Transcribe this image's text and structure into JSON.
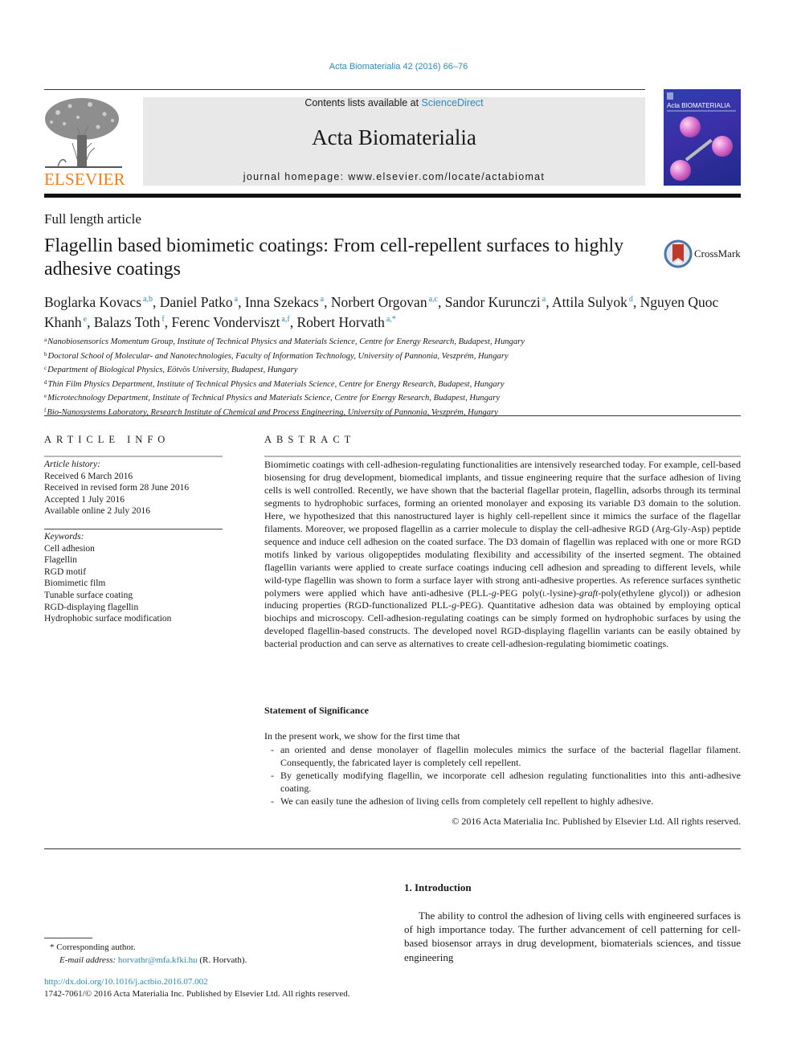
{
  "header": {
    "journal_ref": "Acta Biomaterialia 42 (2016) 66–76",
    "contents_prefix": "Contents lists available at ",
    "contents_link": "ScienceDirect",
    "journal_title": "Acta Biomaterialia",
    "homepage": "journal homepage: www.elsevier.com/locate/actabiomat",
    "publisher": "ELSEVIER",
    "cover_title": "Acta BIOMATERIALIA",
    "colors": {
      "link": "#2a8bb8",
      "elsevier_orange": "#f07d1e",
      "masthead_bg": "#e8e8e8"
    }
  },
  "article": {
    "type": "Full length article",
    "title": "Flagellin based biomimetic coatings: From cell-repellent surfaces to highly adhesive coatings",
    "crossmark_label": "CrossMark",
    "authors": [
      {
        "name": "Boglarka Kovacs",
        "aff": "a,b",
        "sep": ", "
      },
      {
        "name": "Daniel Patko",
        "aff": "a",
        "sep": ", "
      },
      {
        "name": "Inna Szekacs",
        "aff": "a",
        "sep": ", "
      },
      {
        "name": "Norbert Orgovan",
        "aff": "a,c",
        "sep": ", "
      },
      {
        "name": "Sandor Kurunczi",
        "aff": "a",
        "sep": ", "
      },
      {
        "name": "Attila Sulyok",
        "aff": "d",
        "sep": ", "
      },
      {
        "name": "Nguyen Quoc Khanh",
        "aff": "e",
        "sep": ", "
      },
      {
        "name": "Balazs Toth",
        "aff": "f",
        "sep": ", "
      },
      {
        "name": "Ferenc Vonderviszt",
        "aff": "a,f",
        "sep": ", "
      },
      {
        "name": "Robert Horvath",
        "aff": "a,*",
        "sep": ""
      }
    ],
    "affiliations": [
      {
        "key": "a",
        "text": "Nanobiosensorics Momentum Group, Institute of Technical Physics and Materials Science, Centre for Energy Research, Budapest, Hungary"
      },
      {
        "key": "b",
        "text": "Doctoral School of Molecular- and Nanotechnologies, Faculty of Information Technology, University of Pannonia, Veszprém, Hungary"
      },
      {
        "key": "c",
        "text": "Department of Biological Physics, Eötvös University, Budapest, Hungary"
      },
      {
        "key": "d",
        "text": "Thin Film Physics Department, Institute of Technical Physics and Materials Science, Centre for Energy Research, Budapest, Hungary"
      },
      {
        "key": "e",
        "text": "Microtechnology Department, Institute of Technical Physics and Materials Science, Centre for Energy Research, Budapest, Hungary"
      },
      {
        "key": "f",
        "text": "Bio-Nanosystems Laboratory, Research Institute of Chemical and Process Engineering, University of Pannonia, Veszprém, Hungary"
      }
    ]
  },
  "article_info": {
    "heading": "ARTICLE INFO",
    "history_label": "Article history:",
    "history": [
      "Received 6 March 2016",
      "Received in revised form 28 June 2016",
      "Accepted 1 July 2016",
      "Available online 2 July 2016"
    ],
    "keywords_label": "Keywords:",
    "keywords": [
      "Cell adhesion",
      "Flagellin",
      "RGD motif",
      "Biomimetic film",
      "Tunable surface coating",
      "RGD-displaying flagellin",
      "Hydrophobic surface modification"
    ]
  },
  "abstract": {
    "heading": "ABSTRACT",
    "parts": [
      "Biomimetic coatings with cell-adhesion-regulating functionalities are intensively researched today. For example, cell-based biosensing for drug development, biomedical implants, and tissue engineering require that the surface adhesion of living cells is well controlled. Recently, we have shown that the bacterial flagellar protein, flagellin, adsorbs through its terminal segments to hydrophobic surfaces, forming an oriented monolayer and exposing its variable D3 domain to the solution. Here, we hypothesized that this nanostructured layer is highly cell-repellent since it mimics the surface of the flagellar filaments. Moreover, we proposed flagellin as a carrier molecule to display the cell-adhesive RGD (Arg-Gly-Asp) peptide sequence and induce cell adhesion on the coated surface. The D3 domain of flagellin was replaced with one or more RGD motifs linked by various oligopeptides modulating flexibility and accessibility of the inserted segment. The obtained flagellin variants were applied to create surface coatings inducing cell adhesion and spreading to different levels, while wild-type flagellin was shown to form a surface layer with strong anti-adhesive properties. As reference surfaces synthetic polymers were applied which have anti-adhesive (PLL-",
      "g",
      "-PEG poly(",
      "l",
      "-lysine)-",
      "graft",
      "-poly(ethylene glycol)) or adhesion inducing properties (RGD-functionalized PLL-",
      "g",
      "-PEG). Quantitative adhesion data was obtained by employing optical biochips and microscopy. Cell-adhesion-regulating coatings can be simply formed on hydrophobic surfaces by using the developed flagellin-based constructs. The developed novel RGD-displaying flagellin variants can be easily obtained by bacterial production and can serve as alternatives to create cell-adhesion-regulating biomimetic coatings."
    ],
    "significance_heading": "Statement of Significance",
    "significance_intro": "In the present work, we show for the first time that",
    "significance_points": [
      "an oriented and dense monolayer of flagellin molecules mimics the surface of the bacterial flagellar filament. Consequently, the fabricated layer is completely cell repellent.",
      "By genetically modifying flagellin, we incorporate cell adhesion regulating functionalities into this anti-adhesive coating.",
      "We can easily tune the adhesion of living cells from completely cell repellent to highly adhesive."
    ],
    "copyright": "© 2016 Acta Materialia Inc. Published by Elsevier Ltd. All rights reserved."
  },
  "introduction": {
    "heading": "1. Introduction",
    "text": "The ability to control the adhesion of living cells with engineered surfaces is of high importance today. The further advancement of cell patterning for cell-based biosensor arrays in drug development, biomaterials sciences, and tissue engineering"
  },
  "footnotes": {
    "corresponding_mark": "*",
    "corresponding": "Corresponding author.",
    "email_label": "E-mail address:",
    "email": "horvathr@mfa.kfki.hu",
    "email_suffix": " (R. Horvath).",
    "doi": "http://dx.doi.org/10.1016/j.actbio.2016.07.002",
    "issn_line": "1742-7061/© 2016 Acta Materialia Inc. Published by Elsevier Ltd. All rights reserved."
  }
}
